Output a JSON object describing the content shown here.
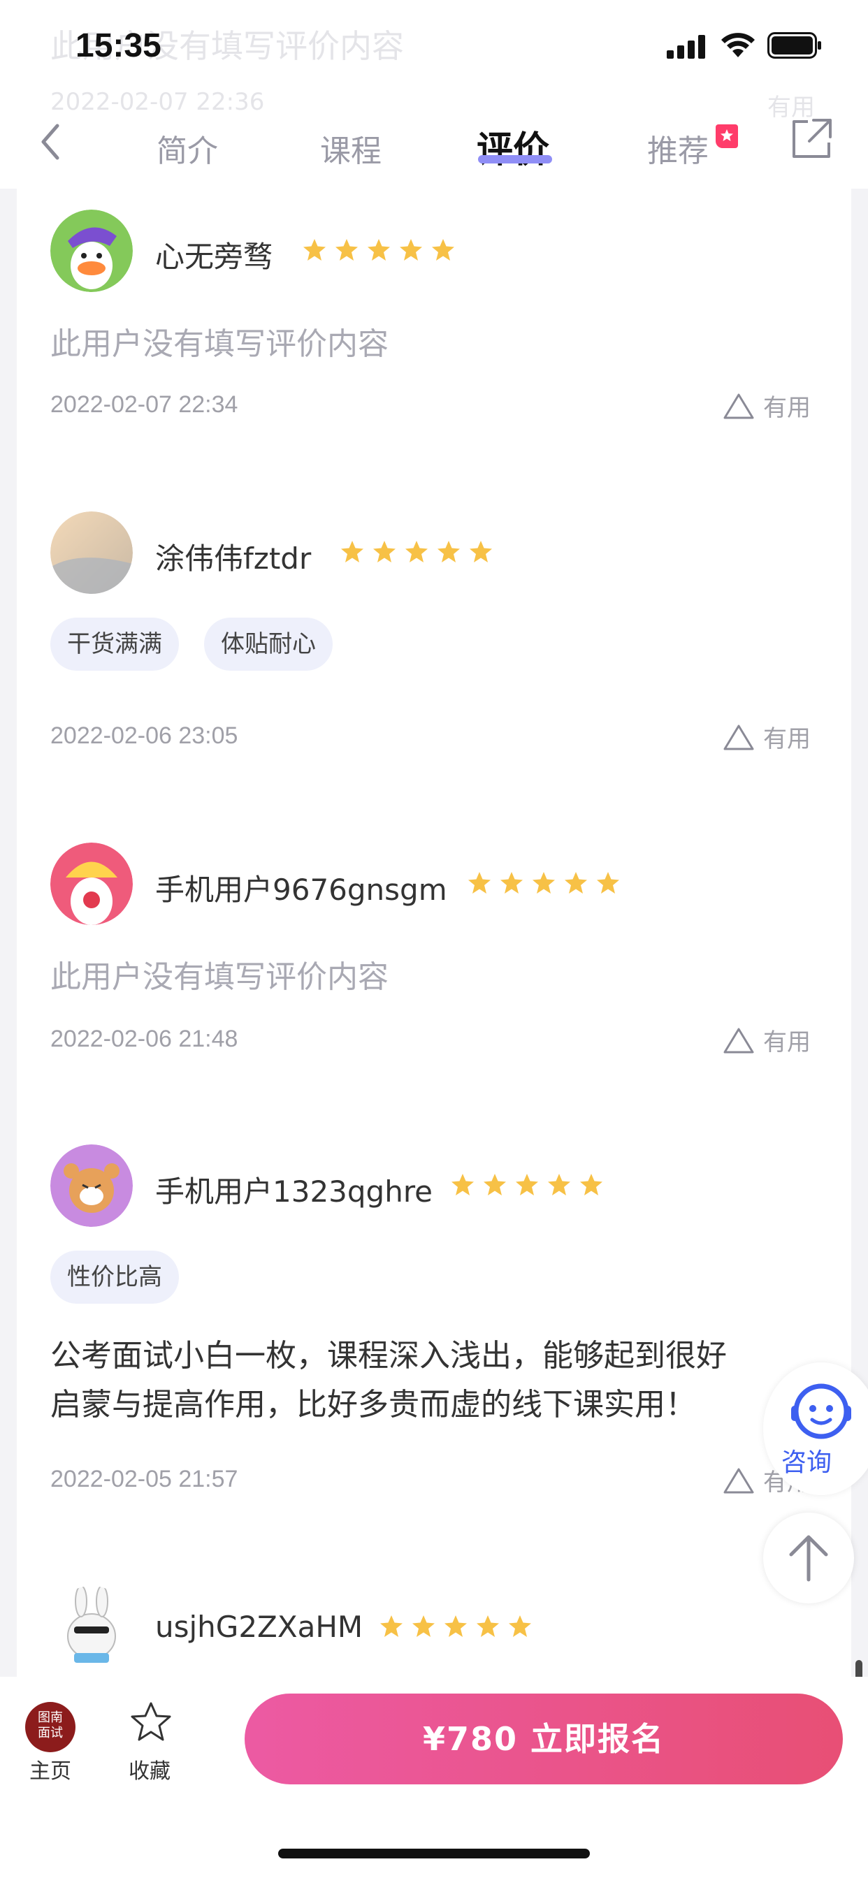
{
  "status": {
    "time": "15:35"
  },
  "ghost": {
    "text": "此用户没有填写评价内容",
    "date": "2022-02-07 22:36",
    "useful": "有用"
  },
  "tabs": [
    "简介",
    "课程",
    "评价",
    "推荐"
  ],
  "reviews": [
    {
      "name": "心无旁骛",
      "text": "此用户没有填写评价内容",
      "date": "2022-02-07 22:34",
      "useful": "有用"
    },
    {
      "name": "涂伟伟fztdr",
      "tags": [
        "干货满满",
        "体贴耐心"
      ],
      "date": "2022-02-06 23:05",
      "useful": "有用"
    },
    {
      "name": "手机用户9676gnsgm",
      "text": "此用户没有填写评价内容",
      "date": "2022-02-06 21:48",
      "useful": "有用"
    },
    {
      "name": "手机用户1323qghre",
      "tags": [
        "性价比高"
      ],
      "text_line1": "公考面试小白一枚，课程深入浅出，能够起到很好",
      "text_line2": "启蒙与提高作用，比好多贵而虚的线下课实用！",
      "date": "2022-02-05 21:57",
      "useful": "有用"
    },
    {
      "name": "usjhG2ZXaHM"
    }
  ],
  "rating": 5,
  "float": {
    "consult": "咨询"
  },
  "bottom": {
    "home_logo_top": "图南",
    "home_logo_bottom": "面试",
    "home": "主页",
    "favorite": "收藏",
    "enroll": "¥780 立即报名"
  },
  "colors": {
    "accent": "#8f8ef6",
    "star": "#f7c146",
    "enroll_start": "#ec5aa3",
    "enroll_end": "#e84f75"
  }
}
